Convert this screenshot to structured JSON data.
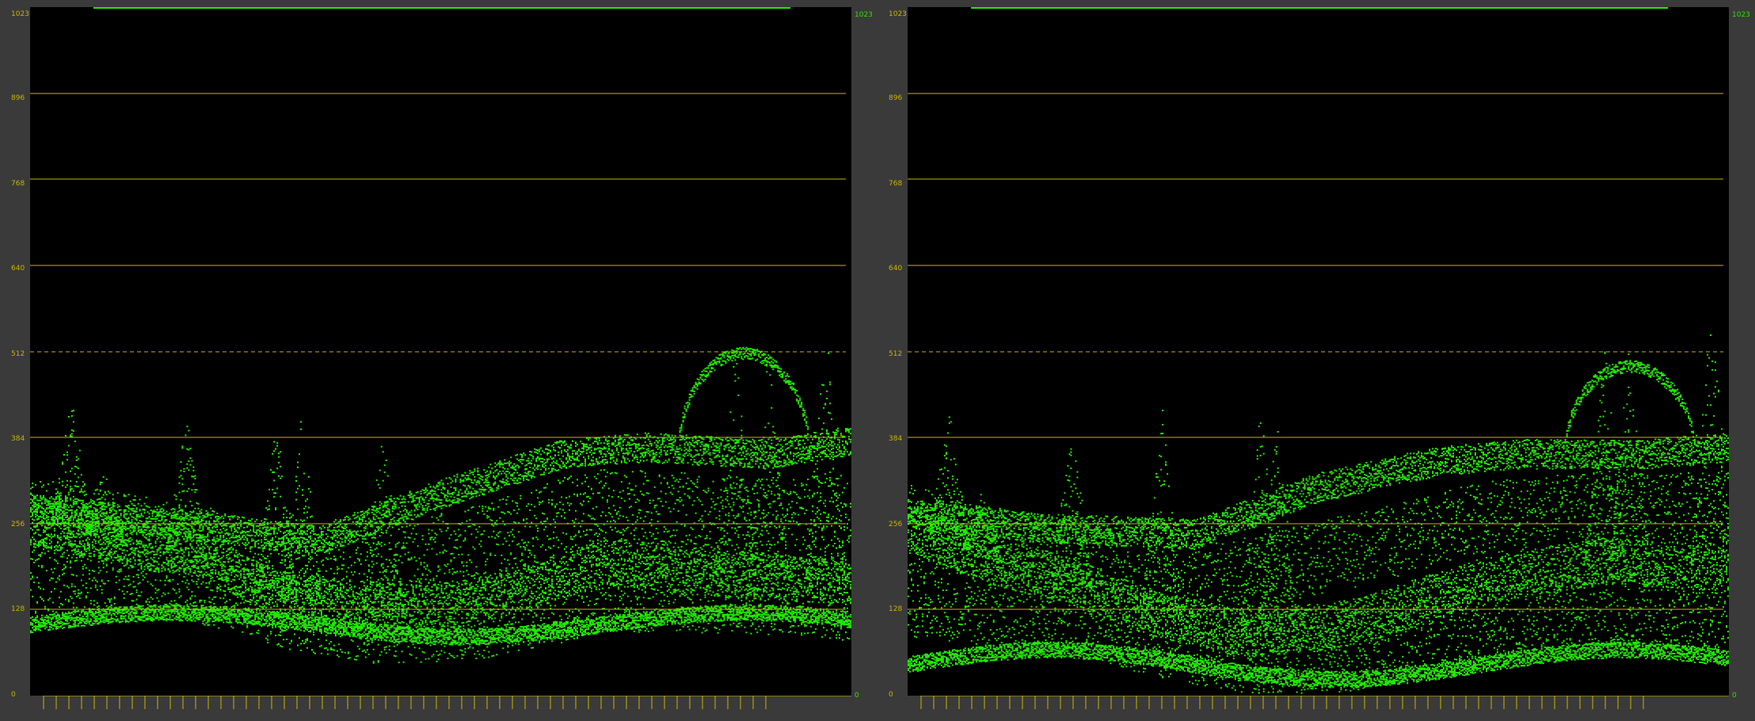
{
  "colors": {
    "background": "#3a3a3a",
    "scope_background": "#000000",
    "graticule": "#c9b400",
    "trace": "#22e800",
    "marker": "#33e000"
  },
  "scale_labels": [
    "1023",
    "896",
    "768",
    "640",
    "512",
    "384",
    "256",
    "128",
    "0"
  ],
  "left_panel": {
    "name": "waveform-left",
    "top_marker": "1023",
    "bottom_marker": "0"
  },
  "right_panel": {
    "name": "waveform-right",
    "top_marker": "1023",
    "bottom_marker": "0"
  }
}
